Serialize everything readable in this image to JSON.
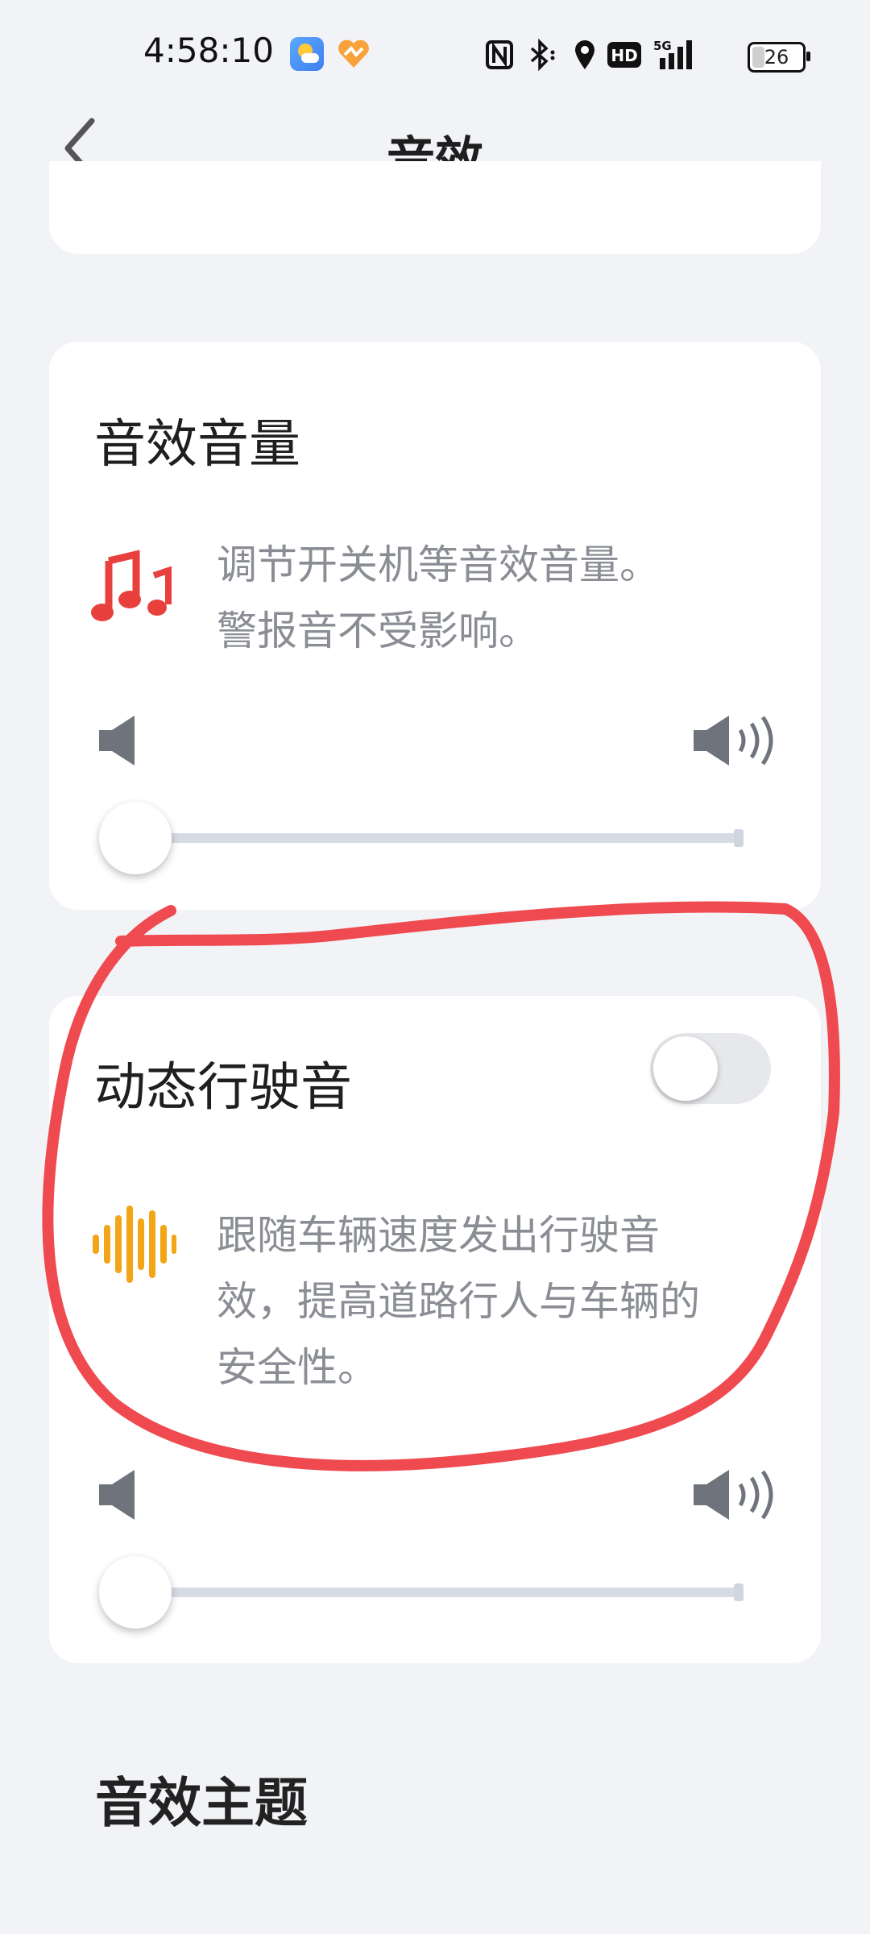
{
  "status_bar": {
    "time": "4:58:10",
    "network": "5G",
    "hd_badge": "HD",
    "battery": "26"
  },
  "header": {
    "title": "音效"
  },
  "sound_volume_card": {
    "title": "音效音量",
    "description_line1": "调节开关机等音效音量。",
    "description_line2": "警报音不受影响。",
    "slider_value": 0
  },
  "driving_sound_card": {
    "title": "动态行驶音",
    "toggle_on": false,
    "description_line1": "跟随车辆速度发出行驶音",
    "description_line2": "效，提高道路行人与车辆的",
    "description_line3": "安全性。",
    "slider_value": 0
  },
  "sound_theme": {
    "title": "音效主题"
  },
  "colors": {
    "background": "#f2f3f7",
    "card": "#ffffff",
    "music_icon": "#e8413d",
    "wave_icon": "#f2a516",
    "annotation": "#ef4a4f"
  }
}
